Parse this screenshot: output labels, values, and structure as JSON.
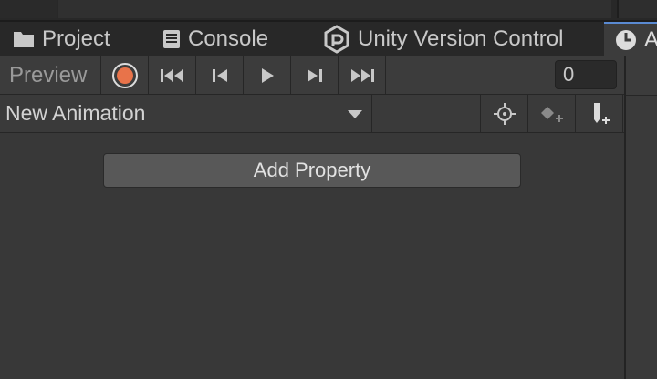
{
  "tabs": [
    {
      "label": "Project",
      "icon": "folder-icon"
    },
    {
      "label": "Console",
      "icon": "console-icon"
    },
    {
      "label": "Unity Version Control",
      "icon": "unity-version-control-icon"
    },
    {
      "label": "A",
      "icon": "animation-clock-icon",
      "active": true
    }
  ],
  "toolbar": {
    "preview_label": "Preview",
    "record_color": "#e8734a",
    "frame_value": "0"
  },
  "clip": {
    "selected": "New Animation"
  },
  "add_property_label": "Add Property"
}
